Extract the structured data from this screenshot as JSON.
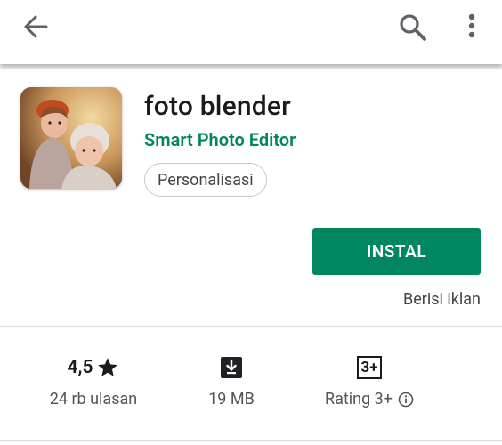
{
  "app": {
    "title": "foto blender",
    "developer": "Smart Photo Editor",
    "category": "Personalisasi"
  },
  "actions": {
    "install_label": "INSTAL",
    "ads_note": "Berisi iklan"
  },
  "stats": {
    "rating_value": "4,5",
    "reviews_label": "24 rb ulasan",
    "size_label": "19 MB",
    "age_badge": "3+",
    "age_label": "Rating 3+"
  },
  "colors": {
    "accent": "#01875f"
  },
  "icons": {
    "back": "arrow-left-icon",
    "search": "search-icon",
    "more": "more-vert-icon",
    "star": "star-icon",
    "download": "download-icon",
    "info": "info-icon"
  }
}
